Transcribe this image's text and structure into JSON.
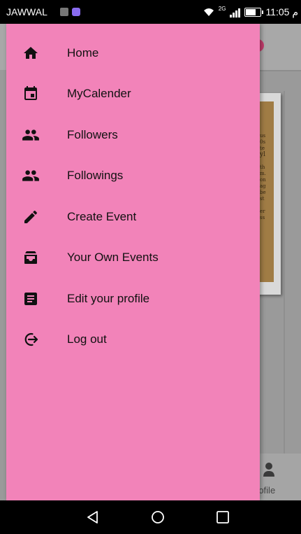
{
  "status_bar": {
    "carrier": "JAWWAL",
    "network": "2G",
    "time": "11:05 م"
  },
  "drawer": {
    "items": [
      {
        "label": "Home",
        "icon": "home-icon"
      },
      {
        "label": "MyCalender",
        "icon": "calendar-icon"
      },
      {
        "label": "Followers",
        "icon": "people-icon"
      },
      {
        "label": "Followings",
        "icon": "people-icon"
      },
      {
        "label": "Create Event",
        "icon": "pencil-icon"
      },
      {
        "label": "Your Own Events",
        "icon": "inbox-icon"
      },
      {
        "label": "Edit your profile",
        "icon": "document-icon"
      },
      {
        "label": "Log out",
        "icon": "logout-icon"
      }
    ]
  },
  "background_app": {
    "bottom_nav_label": "rofile"
  },
  "colors": {
    "drawer_background": "#f283b9",
    "icon_color": "#111111",
    "text_color": "#111111"
  }
}
